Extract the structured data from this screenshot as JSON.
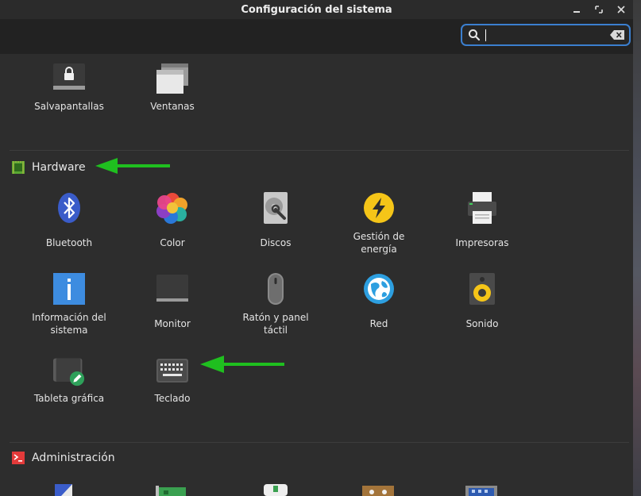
{
  "window": {
    "title": "Configuración del sistema"
  },
  "search": {
    "value": "",
    "placeholder": ""
  },
  "top_items": [
    {
      "label": "Salvapantallas",
      "icon": "screensaver-icon"
    },
    {
      "label": "Ventanas",
      "icon": "windows-icon"
    }
  ],
  "sections": {
    "hardware": {
      "label": "Hardware"
    },
    "admin": {
      "label": "Administración"
    }
  },
  "hardware_items": [
    {
      "label": "Bluetooth"
    },
    {
      "label": "Color"
    },
    {
      "label": "Discos"
    },
    {
      "label_line1": "Gestión de",
      "label_line2": "energía"
    },
    {
      "label": "Impresoras"
    },
    {
      "label_line1": "Información del",
      "label_line2": "sistema"
    },
    {
      "label": "Monitor"
    },
    {
      "label_line1": "Ratón y panel",
      "label_line2": "táctil"
    },
    {
      "label": "Red"
    },
    {
      "label": "Sonido"
    },
    {
      "label": "Tableta gráfica"
    },
    {
      "label": "Teclado"
    }
  ],
  "colors": {
    "accent": "#3b7fcf",
    "arrow": "#1fbf1f",
    "background": "#2d2d2d"
  }
}
